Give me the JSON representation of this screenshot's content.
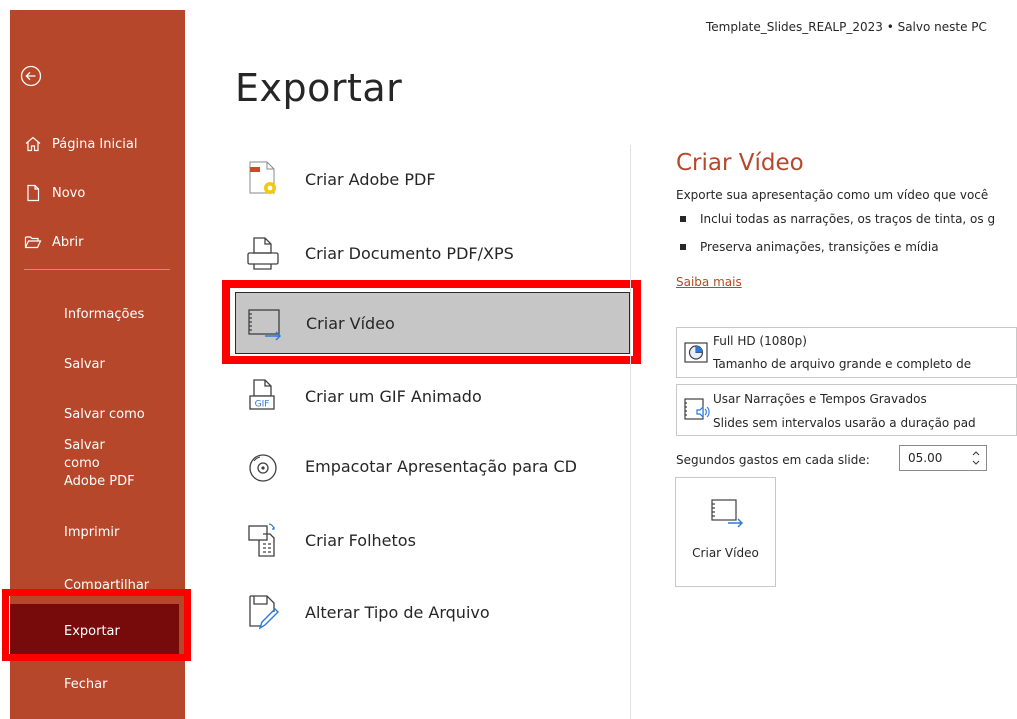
{
  "window": {
    "doc_title": "Template_Slides_REALP_2023 • Salvo neste PC"
  },
  "sidebar": {
    "items": [
      {
        "label": "Página Inicial",
        "icon": "home-icon"
      },
      {
        "label": "Novo",
        "icon": "new-document-icon"
      },
      {
        "label": "Abrir",
        "icon": "open-folder-icon"
      },
      {
        "label": "Informações"
      },
      {
        "label": "Salvar"
      },
      {
        "label": "Salvar como"
      },
      {
        "label": "Salvar como Adobe PDF"
      },
      {
        "label": "Imprimir"
      },
      {
        "label": "Compartilhar"
      },
      {
        "label": "Exportar",
        "active": true
      },
      {
        "label": "Fechar"
      }
    ],
    "colors": {
      "background": "#b7472a",
      "active": "#770a0a",
      "highlight": "#ff0000"
    }
  },
  "main": {
    "title": "Exportar",
    "options": [
      {
        "label": "Criar Adobe PDF",
        "icon": "adobe-pdf-icon"
      },
      {
        "label": "Criar Documento PDF/XPS",
        "icon": "pdf-xps-icon"
      },
      {
        "label": "Criar Vídeo",
        "icon": "video-icon",
        "selected": true
      },
      {
        "label": "Criar um GIF Animado",
        "icon": "gif-icon"
      },
      {
        "label": "Empacotar Apresentação para CD",
        "icon": "cd-icon"
      },
      {
        "label": "Criar Folhetos",
        "icon": "handouts-icon"
      },
      {
        "label": "Alterar Tipo de Arquivo",
        "icon": "change-file-type-icon"
      }
    ]
  },
  "panel": {
    "title": "Criar Vídeo",
    "description": "Exporte sua apresentação como um vídeo que você",
    "bullets": [
      "Inclui todas as narrações, os traços de tinta, os g",
      "Preserva animações, transições e mídia"
    ],
    "learn_more": "Saiba mais",
    "quality": {
      "title": "Full HD (1080p)",
      "desc": "Tamanho de arquivo grande e completo de"
    },
    "timings": {
      "title": "Usar Narrações e Tempos Gravados",
      "desc": "Slides sem intervalos usarão a duração pad"
    },
    "seconds_label": "Segundos gastos em cada slide:",
    "seconds_value": "05.00",
    "create_button": "Criar Vídeo",
    "accent": "#b7472a"
  }
}
